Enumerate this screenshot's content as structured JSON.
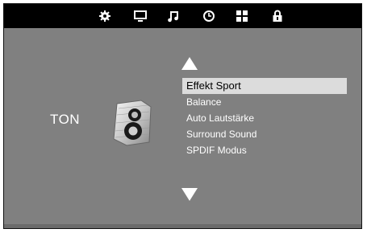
{
  "topbar": {
    "icons": [
      "gear-icon",
      "monitor-icon",
      "music-note-icon",
      "clock-icon",
      "grid-icon",
      "lock-icon"
    ]
  },
  "section": {
    "title": "TON",
    "icon": "speaker-icon"
  },
  "menu": {
    "selected_index": 0,
    "items": [
      {
        "label": "Effekt Sport"
      },
      {
        "label": "Balance"
      },
      {
        "label": "Auto Lautstärke"
      },
      {
        "label": "Surround Sound"
      },
      {
        "label": "SPDIF Modus"
      }
    ]
  },
  "colors": {
    "background": "#808080",
    "topbar": "#000000",
    "highlight": "#dcdcdc",
    "text": "#ffffff"
  }
}
